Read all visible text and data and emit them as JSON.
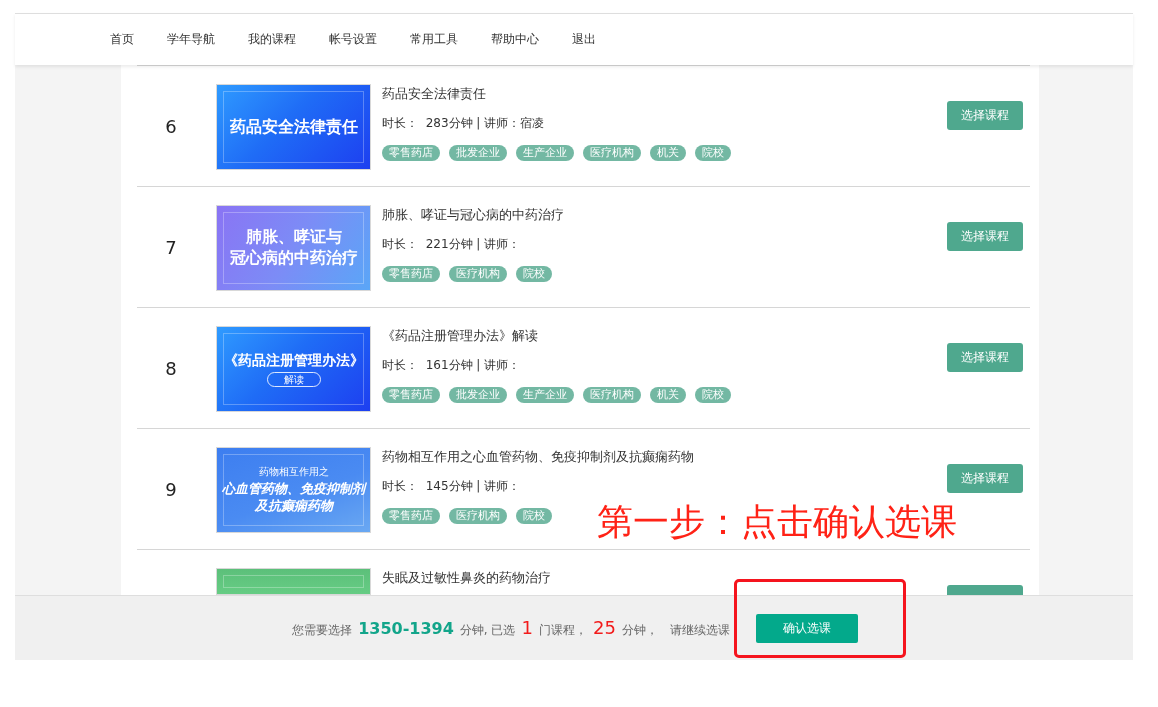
{
  "nav": [
    "首页",
    "学年导航",
    "我的课程",
    "帐号设置",
    "常用工具",
    "帮助中心",
    "退出"
  ],
  "courses": [
    {
      "number": "6",
      "cover": {
        "kind": "blue",
        "lines": [
          "药品安全法律责任"
        ]
      },
      "title": "药品安全法律责任",
      "meta": "时长：  283分钟 | 讲师：宿凌",
      "tags": [
        "零售药店",
        "批发企业",
        "生产企业",
        "医疗机构",
        "机关",
        "院校"
      ],
      "button": "选择课程",
      "cut": false
    },
    {
      "number": "7",
      "cover": {
        "kind": "violet",
        "lines": [
          "肺胀、哮证与",
          "冠心病的中药治疗"
        ]
      },
      "title": "肺胀、哮证与冠心病的中药治疗",
      "meta": "时长：  221分钟 | 讲师：",
      "tags": [
        "零售药店",
        "医疗机构",
        "院校"
      ],
      "button": "选择课程",
      "cut": false
    },
    {
      "number": "8",
      "cover": {
        "kind": "blue",
        "lines": [
          "《药品注册管理办法》"
        ],
        "badge": "解读"
      },
      "title": "《药品注册管理办法》解读",
      "meta": "时长：  161分钟 | 讲师：",
      "tags": [
        "零售药店",
        "批发企业",
        "生产企业",
        "医疗机构",
        "机关",
        "院校"
      ],
      "button": "选择课程",
      "cut": false
    },
    {
      "number": "9",
      "cover": {
        "kind": "sky",
        "kicker": "药物相互作用之",
        "lines": [
          "心血管药物、免疫抑制剂",
          "及抗癫痫药物"
        ]
      },
      "title": "药物相互作用之心血管药物、免疫抑制剂及抗癫痫药物",
      "meta": "时长：  145分钟 | 讲师：",
      "tags": [
        "零售药店",
        "医疗机构",
        "院校"
      ],
      "button": "选择课程",
      "cut": false
    },
    {
      "cover": {
        "kind": "green"
      },
      "title": "失眠及过敏性鼻炎的药物治疗",
      "cut": true
    }
  ],
  "annotation": {
    "text": "第一步：点击确认选课"
  },
  "footer": {
    "summary": [
      {
        "kind": "text",
        "text": "您需要选择"
      },
      {
        "kind": "range",
        "text": "1350-1394"
      },
      {
        "kind": "text",
        "text": "分钟, 已选"
      },
      {
        "kind": "count",
        "text": "1"
      },
      {
        "kind": "text",
        "text": "门课程，"
      },
      {
        "kind": "count",
        "text": "25"
      },
      {
        "kind": "text",
        "text": "分钟，"
      },
      {
        "kind": "hint",
        "text": "请继续选课"
      }
    ],
    "confirm_button": "确认选课"
  }
}
